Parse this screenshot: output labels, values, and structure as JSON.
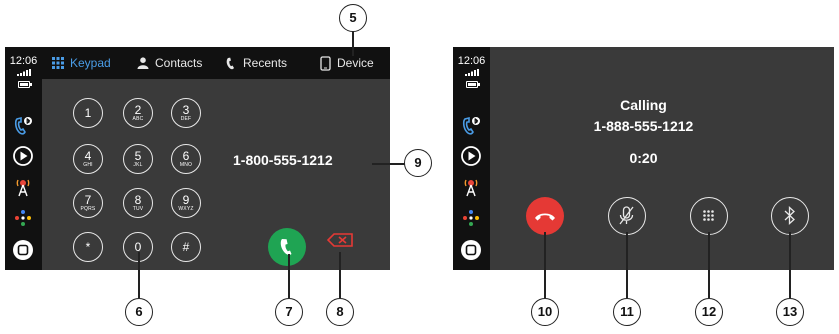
{
  "left_screen": {
    "status": {
      "time": "12:06"
    },
    "tabs": [
      {
        "label": "Keypad",
        "icon": "keypad-icon",
        "active": true
      },
      {
        "label": "Contacts",
        "icon": "person-icon"
      },
      {
        "label": "Recents",
        "icon": "phone-handset-icon"
      },
      {
        "label": "Device",
        "icon": "device-phone-icon"
      }
    ],
    "keypad": [
      {
        "digit": "1",
        "letters": ""
      },
      {
        "digit": "2",
        "letters": "ABC"
      },
      {
        "digit": "3",
        "letters": "DEF"
      },
      {
        "digit": "4",
        "letters": "GHI"
      },
      {
        "digit": "5",
        "letters": "JKL"
      },
      {
        "digit": "6",
        "letters": "MNO"
      },
      {
        "digit": "7",
        "letters": "PQRS"
      },
      {
        "digit": "8",
        "letters": "TUV"
      },
      {
        "digit": "9",
        "letters": "WXYZ"
      },
      {
        "digit": "*",
        "letters": ""
      },
      {
        "digit": "0",
        "letters": ""
      },
      {
        "digit": "#",
        "letters": ""
      }
    ],
    "dialed_number": "1-800-555-1212"
  },
  "right_screen": {
    "status": {
      "time": "12:06"
    },
    "status_label": "Calling",
    "number": "1-888-555-1212",
    "duration": "0:20",
    "buttons": [
      "end-call-icon",
      "mute-icon",
      "keypad-icon",
      "bluetooth-icon"
    ]
  },
  "callouts": [
    "5",
    "6",
    "7",
    "8",
    "9",
    "10",
    "11",
    "12",
    "13"
  ],
  "colors": {
    "active_tab": "#4a9ce6",
    "call_green": "#1fa453",
    "end_red": "#e53935",
    "screen_bg": "#3a3a3a",
    "bar_bg": "#111111"
  }
}
